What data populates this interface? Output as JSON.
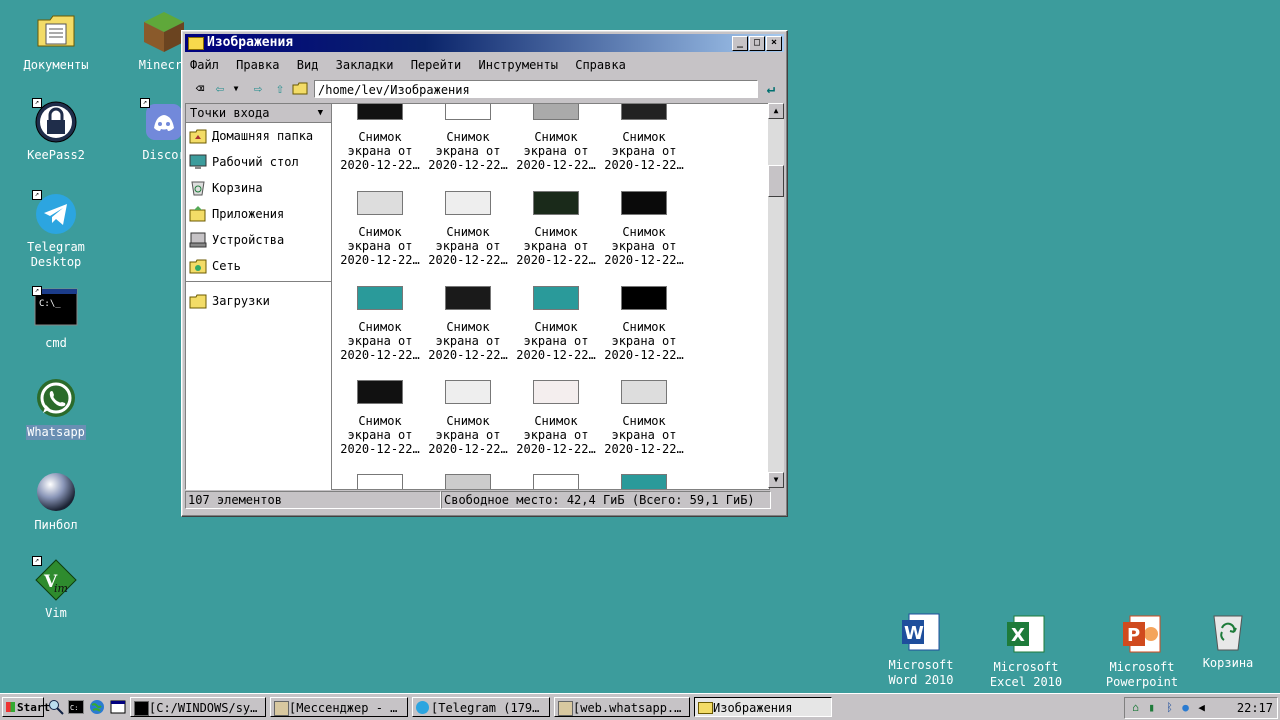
{
  "desktop_left": [
    {
      "label": "Документы",
      "icon": "documents-folder-icon",
      "selected": false
    },
    {
      "label": "KeePass2",
      "icon": "keepass-lock-icon",
      "selected": false
    },
    {
      "label": "Telegram Desktop",
      "icon": "telegram-icon",
      "selected": false
    },
    {
      "label": "cmd",
      "icon": "cmd-console-icon",
      "selected": false
    },
    {
      "label": "Whatsapp",
      "icon": "whatsapp-icon",
      "selected": true
    },
    {
      "label": "Пинбол",
      "icon": "pinball-ball-icon",
      "selected": false
    },
    {
      "label": "Vim",
      "icon": "vim-icon",
      "selected": false
    }
  ],
  "desktop_left2": [
    {
      "label": "Minecra",
      "icon": "minecraft-block-icon"
    },
    {
      "label": "Discor",
      "icon": "discord-icon"
    }
  ],
  "desktop_right": [
    {
      "label": "Microsoft Word 2010",
      "icon": "word-icon"
    },
    {
      "label": "Microsoft Excel 2010",
      "icon": "excel-icon"
    },
    {
      "label": "Microsoft Powerpoint …",
      "icon": "powerpoint-icon"
    },
    {
      "label": "Корзина",
      "icon": "recycle-bin-icon"
    }
  ],
  "window": {
    "title": "Изображения",
    "menu": [
      "Файл",
      "Правка",
      "Вид",
      "Закладки",
      "Перейти",
      "Инструменты",
      "Справка"
    ],
    "address": "/home/lev/Изображения",
    "sidebar_header": "Точки входа",
    "sidebar": [
      {
        "label": "Домашняя папка",
        "icon": "home-folder-icon"
      },
      {
        "label": "Рабочий стол",
        "icon": "desktop-icon"
      },
      {
        "label": "Корзина",
        "icon": "trash-icon"
      },
      {
        "label": "Приложения",
        "icon": "applications-icon"
      },
      {
        "label": "Устройства",
        "icon": "devices-icon"
      },
      {
        "label": "Сеть",
        "icon": "network-icon"
      }
    ],
    "sidebar_bookmarks": [
      {
        "label": "Загрузки",
        "icon": "downloads-folder-icon"
      }
    ],
    "file_line1": "Снимок",
    "file_line2": "экрана от",
    "file_line3": "2020-12-22…",
    "status_count": "107 элементов",
    "status_free": "Свободное место: 42,4 ГиБ (Всего: 59,1 ГиБ)"
  },
  "taskbar": {
    "start": "Start",
    "tasks": [
      {
        "label": "[C:/WINDOWS/sy…",
        "icon": "console-icon",
        "active": false
      },
      {
        "label": "[Мессенджер - …",
        "icon": "messenger-icon",
        "active": false
      },
      {
        "label": "[Telegram (179…",
        "icon": "telegram-icon",
        "active": false
      },
      {
        "label": "[web.whatsapp.…",
        "icon": "whatsapp-web-icon",
        "active": false
      },
      {
        "label": "Изображения",
        "icon": "folder-icon",
        "active": true
      }
    ],
    "clock": "22:17"
  },
  "colors": {
    "desktop": "#3c9c9c",
    "title_start": "#00007f",
    "window": "#c6c3c6"
  }
}
